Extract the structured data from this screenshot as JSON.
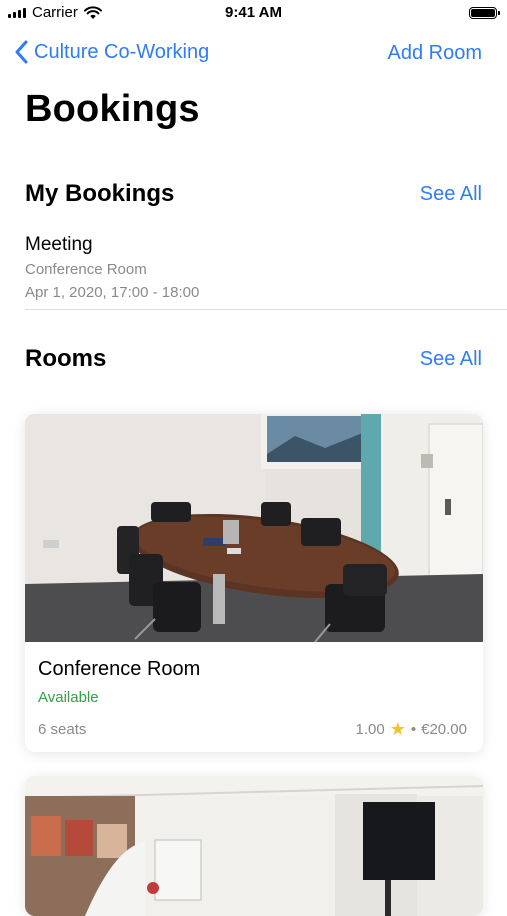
{
  "status_bar": {
    "carrier": "Carrier",
    "time": "9:41 AM"
  },
  "nav": {
    "back_label": "Culture Co-Working",
    "add_room_label": "Add Room"
  },
  "page_title": "Bookings",
  "my_bookings": {
    "title": "My Bookings",
    "see_all": "See All",
    "items": [
      {
        "name": "Meeting",
        "room": "Conference Room",
        "datetime": "Apr 1, 2020, 17:00 - 18:00"
      }
    ]
  },
  "rooms": {
    "title": "Rooms",
    "see_all": "See All",
    "items": [
      {
        "name": "Conference Room",
        "availability": "Available",
        "seats": "6 seats",
        "rating": "1.00",
        "price": "€20.00"
      }
    ]
  },
  "colors": {
    "accent": "#2f7cf6",
    "available": "#2fa14a",
    "secondary_text": "#8a8a8e"
  },
  "icons": {
    "signal": "cellular-signal-icon",
    "wifi": "wifi-icon",
    "battery": "battery-icon",
    "back": "chevron-left-icon",
    "rating": "star-icon"
  }
}
